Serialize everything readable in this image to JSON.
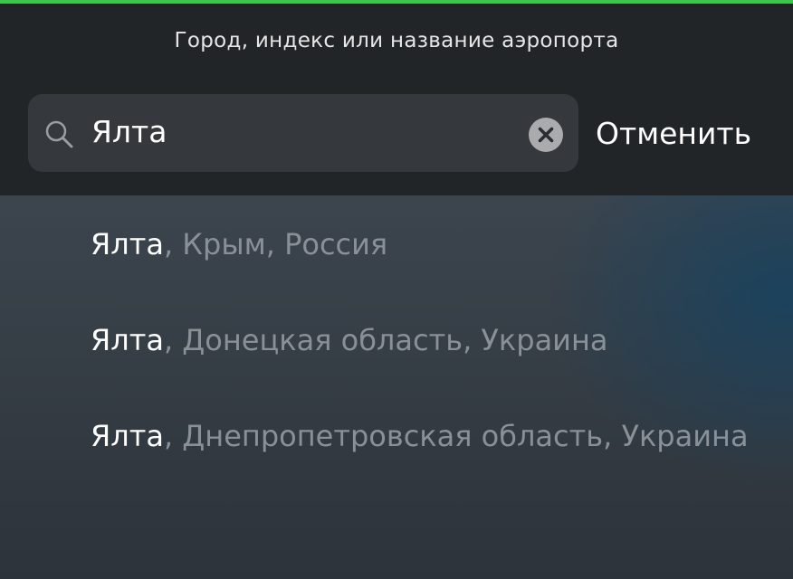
{
  "header": {
    "prompt": "Город, индекс или название аэропорта"
  },
  "search": {
    "value": "Ялта",
    "icon": "search-icon",
    "clear_icon": "clear-icon",
    "cancel_label": "Отменить"
  },
  "results": [
    {
      "city": "Ялта",
      "region": ", Крым, Россия"
    },
    {
      "city": "Ялта",
      "region": ", Донецкая область, Украина"
    },
    {
      "city": "Ялта",
      "region": ", Днепропетровская область, Украина"
    }
  ],
  "colors": {
    "accent_strip": "#3cc84a",
    "header_bg": "#222528",
    "search_bg": "#35383c",
    "secondary_text": "#8a9097"
  }
}
